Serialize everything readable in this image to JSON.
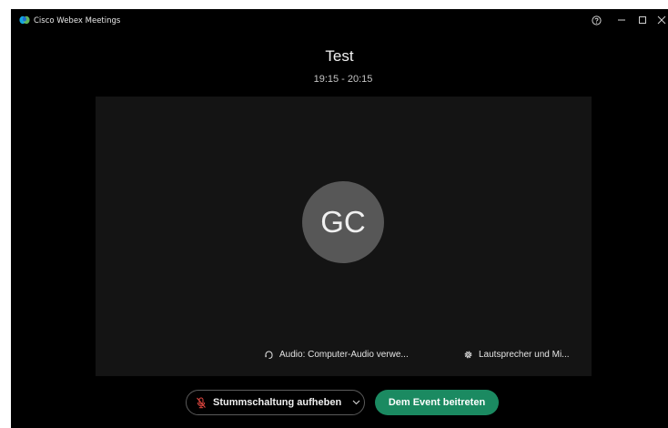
{
  "window": {
    "app_title": "Cisco Webex Meetings",
    "controls": {
      "help_icon": "help-circle-icon",
      "minimize_icon": "minimize-icon",
      "maximize_icon": "maximize-icon",
      "close_icon": "close-icon"
    }
  },
  "meeting": {
    "title": "Test",
    "time": "19:15 - 20:15"
  },
  "preview": {
    "avatar_initials": "GC",
    "audio_label": "Audio: Computer-Audio verwe...",
    "audio_icon": "headset-icon",
    "speaker_label": "Lautsprecher und Mi...",
    "speaker_icon": "gear-icon"
  },
  "actions": {
    "mute_label": "Stummschaltung aufheben",
    "mute_icon": "microphone-muted-icon",
    "dropdown_icon": "chevron-down-icon",
    "join_label": "Dem Event beitreten"
  },
  "colors": {
    "background": "#000000",
    "preview_background": "#141414",
    "avatar": "#575757",
    "join_button": "#1b8a61",
    "mute_icon": "#e0463f"
  }
}
